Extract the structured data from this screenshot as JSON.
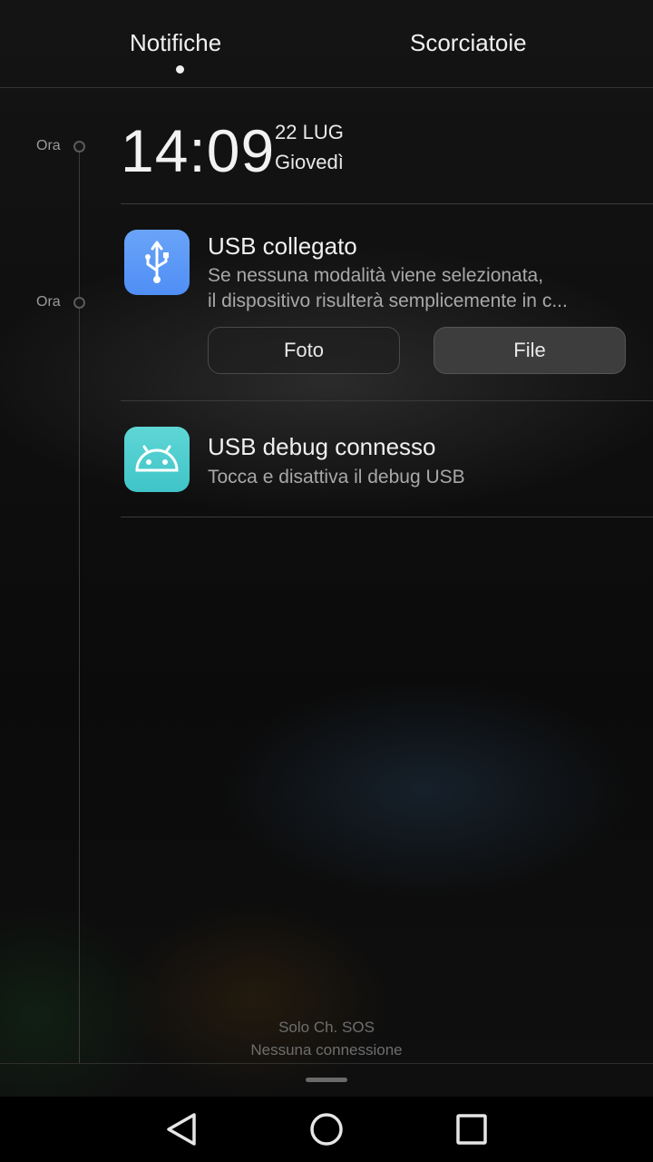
{
  "tabs": {
    "notifications": "Notifiche",
    "shortcuts": "Scorciatoie"
  },
  "timeline": {
    "label1": "Ora",
    "label2": "Ora"
  },
  "clock": {
    "time": "14:09",
    "date": "22 LUG",
    "weekday": "Giovedì"
  },
  "notifications": [
    {
      "icon": "usb-icon",
      "title": "USB collegato",
      "line1": "Se nessuna modalità viene selezionata,",
      "line2": "il dispositivo risulterà semplicemente in c...",
      "actions": [
        "Foto",
        "File"
      ],
      "icon_color": "#5b97f6"
    },
    {
      "icon": "android-icon",
      "title": "USB debug connesso",
      "line1": "Tocca e disattiva il debug USB",
      "icon_color": "#4ccccf"
    }
  ],
  "status": {
    "line1": "Solo Ch. SOS",
    "line2": "Nessuna connessione"
  },
  "navbar": {
    "back": "back-icon",
    "home": "home-icon",
    "recents": "recents-icon"
  }
}
